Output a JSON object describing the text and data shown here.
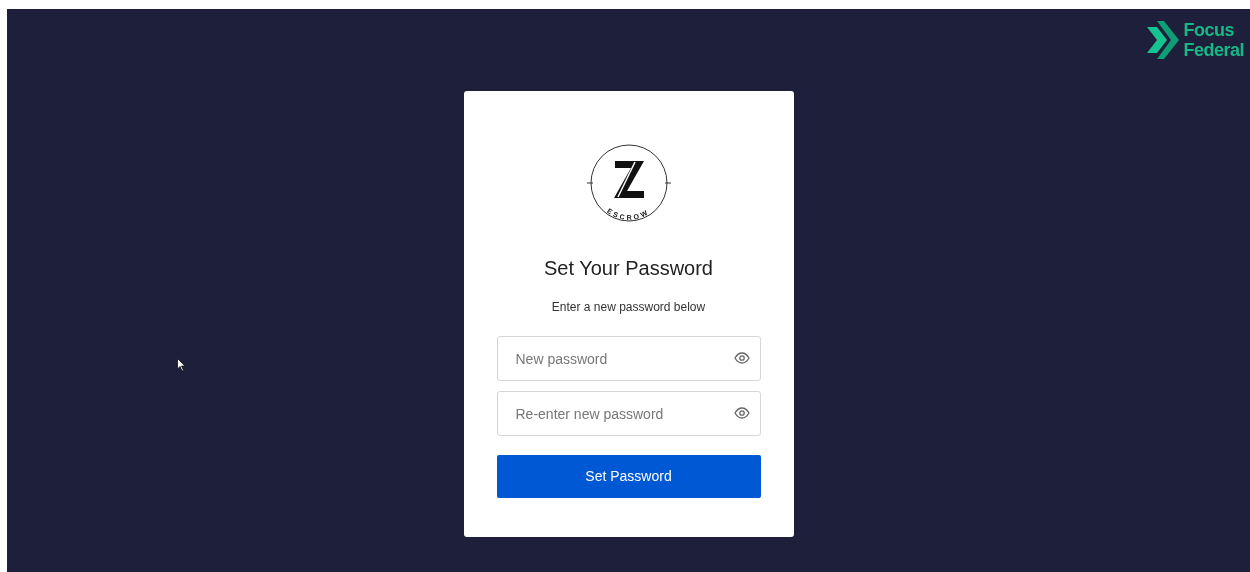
{
  "brand": {
    "line_1": "Focus",
    "line_2": "Federal"
  },
  "card": {
    "logo_text": "ESCROW",
    "title": "Set Your Password",
    "subtitle": "Enter a new password below",
    "fields": [
      {
        "placeholder": "New password"
      },
      {
        "placeholder": "Re-enter new password"
      }
    ],
    "button": "Set Password"
  }
}
